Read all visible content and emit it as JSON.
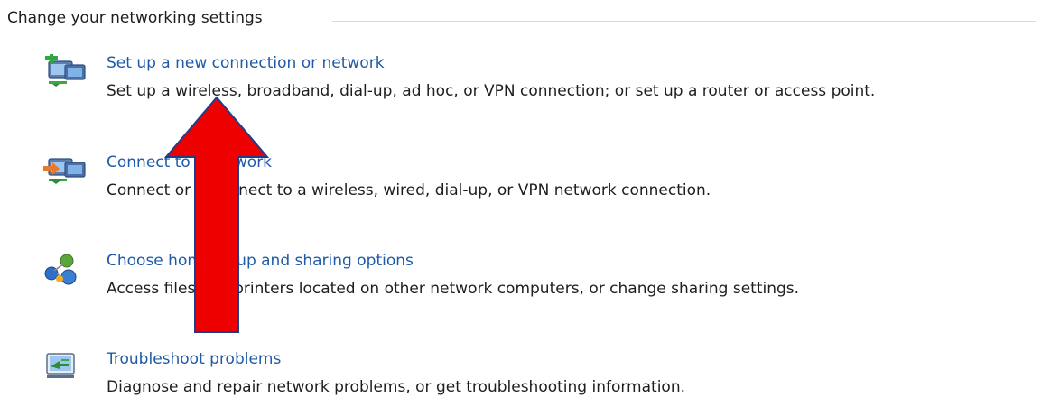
{
  "section": {
    "title": "Change your networking settings"
  },
  "tasks": [
    {
      "icon": "new-connection-icon",
      "link": "Set up a new connection or network",
      "description": "Set up a wireless, broadband, dial-up, ad hoc, or VPN connection; or set up a router or access point."
    },
    {
      "icon": "connect-network-icon",
      "link": "Connect to a network",
      "description": "Connect or reconnect to a wireless, wired, dial-up, or VPN network connection."
    },
    {
      "icon": "homegroup-icon",
      "link": "Choose homegroup and sharing options",
      "description": "Access files and printers located on other network computers, or change sharing settings."
    },
    {
      "icon": "troubleshoot-icon",
      "link": "Troubleshoot problems",
      "description": "Diagnose and repair network problems, or get troubleshooting information."
    }
  ],
  "annotation": {
    "icon": "red-up-arrow",
    "fill_color": "#ee0000",
    "stroke_color": "#1f3d8a"
  },
  "colors": {
    "link": "#1e5aa8",
    "text": "#1e1e1e",
    "rule": "#d8d8d8"
  }
}
